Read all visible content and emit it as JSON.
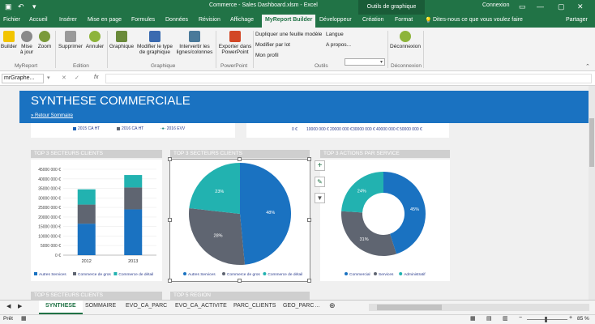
{
  "app": {
    "title": "Commerce - Sales Dashboard.xlsm  -  Excel",
    "context_group": "Outils de graphique",
    "connect": "Connexion"
  },
  "tabs": [
    {
      "label": "Fichier"
    },
    {
      "label": "Accueil"
    },
    {
      "label": "Insérer"
    },
    {
      "label": "Mise en page"
    },
    {
      "label": "Formules"
    },
    {
      "label": "Données"
    },
    {
      "label": "Révision"
    },
    {
      "label": "Affichage"
    },
    {
      "label": "MyReport Builder"
    },
    {
      "label": "Développeur"
    },
    {
      "label": "Création"
    },
    {
      "label": "Format"
    }
  ],
  "tell_me": "Dites-nous ce que vous voulez faire",
  "share": "Partager",
  "ribbon": {
    "builder": "Builder",
    "maj": "Mise\nà jour",
    "zoom": "Zoom",
    "supprimer": "Supprimer",
    "annuler": "Annuler",
    "graphique": "Graphique",
    "modifier_type": "Modifier le type\nde graphique",
    "intervertir": "Intervertir les\nlignes/colonnes",
    "exporter": "Exporter dans\nPowerPoint",
    "dupliquer": "Dupliquer une feuille modèle",
    "langue": "Langue",
    "modifier_lot": "Modifier par lot",
    "apropos": "A propos...",
    "profil": "Mon profil",
    "deconnexion": "Déconnexion",
    "groups": {
      "myreport": "MyReport",
      "edition": "Edition",
      "graphique": "Graphique",
      "powerpoint": "PowerPoint",
      "outils": "Outils",
      "deconnexion": "Déconnexion"
    }
  },
  "namebox": "mrGraphe...",
  "fx": "fx",
  "dashboard": {
    "title": "SYNTHESE COMMERCIALE",
    "link": "» Retour Sommaire",
    "legend_top": [
      {
        "label": "2015 CA HT",
        "color": "#1a5fb4"
      },
      {
        "label": "2016 CA HT",
        "color": "#5f6571"
      },
      {
        "label": "2016 EVV",
        "color": "#21867a"
      }
    ],
    "axis_top": [
      "0 €",
      "10000 000 €",
      "20000 000 €",
      "30000 000 €",
      "40000 000 €",
      "50000 000 €"
    ],
    "sec1": "TOP 3 SECTEURS CLIENTS",
    "sec2": "TOP 3 SECTEURS CLIENTS",
    "sec3": "TOP 3 ACTIONS PAR SERVICE",
    "sec4": "TOP 5 SECTEURS CLIENTS",
    "sec5": "TOP 5 REGION"
  },
  "chart_data": [
    {
      "type": "bar",
      "stacked": true,
      "categories": [
        "2012",
        "2013"
      ],
      "series": [
        {
          "name": "Autres Services",
          "color": "#1a72c1",
          "values": [
            16500000,
            24000000
          ]
        },
        {
          "name": "Commerce de gros",
          "color": "#5f6571",
          "values": [
            10000000,
            11500000
          ]
        },
        {
          "name": "Commerce de détail",
          "color": "#22b2b0",
          "values": [
            8000000,
            6500000
          ]
        }
      ],
      "ylim": [
        0,
        45000000
      ],
      "yticks": [
        "0 €",
        "5000 000 €",
        "10000 000 €",
        "15000 000 €",
        "20000 000 €",
        "25000 000 €",
        "30000 000 €",
        "35000 000 €",
        "40000 000 €",
        "45000 000 €"
      ]
    },
    {
      "type": "pie",
      "slices": [
        {
          "name": "Autres Services",
          "value": 48,
          "label": "48%",
          "color": "#1a72c1"
        },
        {
          "name": "Commerce de gros",
          "value": 28,
          "label": "28%",
          "color": "#5f6571"
        },
        {
          "name": "Commerce de détail",
          "value": 23,
          "label": "23%",
          "color": "#22b2b0"
        }
      ]
    },
    {
      "type": "pie",
      "donut": true,
      "slices": [
        {
          "name": "Commercial",
          "value": 45,
          "label": "45%",
          "color": "#1a72c1"
        },
        {
          "name": "Services",
          "value": 31,
          "label": "31%",
          "color": "#5f6571"
        },
        {
          "name": "Administratif",
          "value": 24,
          "label": "24%",
          "color": "#22b2b0"
        }
      ]
    }
  ],
  "sheets": [
    {
      "label": "SYNTHESE",
      "active": true
    },
    {
      "label": "SOMMAIRE"
    },
    {
      "label": "EVO_CA_PARC"
    },
    {
      "label": "EVO_CA_ACTIVITE"
    },
    {
      "label": "PARC_CLIENTS"
    },
    {
      "label": "GEO_PARC"
    }
  ],
  "status": {
    "left": "Prêt",
    "zoom": "85 %"
  },
  "colors": {
    "excel_green": "#217346",
    "banner_blue": "#1a72c1"
  }
}
